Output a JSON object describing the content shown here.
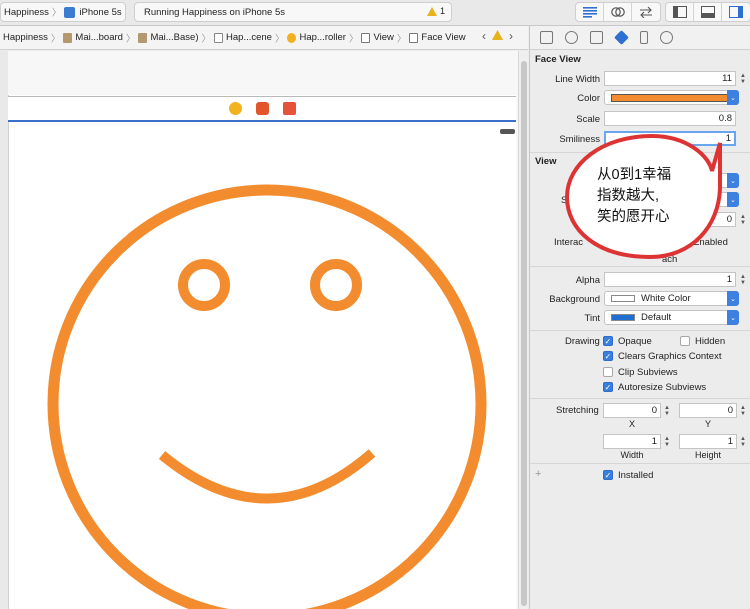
{
  "toolbar": {
    "scheme_app": "Happiness",
    "scheme_device": "iPhone 5s",
    "status_text": "Running Happiness on iPhone 5s",
    "warning_count": "1"
  },
  "jumpbar": {
    "crumbs": [
      "Happiness",
      "Mai...board",
      "Mai...Base)",
      "Hap...cene",
      "Hap...roller",
      "View",
      "Face View"
    ]
  },
  "inspector": {
    "face_view": {
      "title": "Face View",
      "line_width_label": "Line Width",
      "line_width_value": "11",
      "color_label": "Color",
      "color_value": "#F28C2E",
      "scale_label": "Scale",
      "scale_value": "0.8",
      "smiliness_label": "Smiliness",
      "smiliness_value": "1"
    },
    "view": {
      "title": "View",
      "s_label": "S",
      "field3_value": "0",
      "interaction_label": "Interac",
      "enabled_text": "Enabled",
      "touch_text": "ach",
      "alpha_label": "Alpha",
      "alpha_value": "1",
      "background_label": "Background",
      "background_value": "White Color",
      "tint_label": "Tint",
      "tint_value": "Default",
      "drawing_label": "Drawing",
      "opaque": "Opaque",
      "hidden": "Hidden",
      "clears": "Clears Graphics Context",
      "clip": "Clip Subviews",
      "autoresize": "Autoresize Subviews",
      "stretching_label": "Stretching",
      "x_value": "0",
      "y_value": "0",
      "x_label": "X",
      "y_label": "Y",
      "w_value": "1",
      "h_value": "1",
      "width_label": "Width",
      "height_label": "Height",
      "installed": "Installed"
    }
  },
  "callout": {
    "line1": "从0到1幸福",
    "line2": "指数越大,",
    "line3": "笑的愿开心"
  },
  "colors": {
    "face_stroke": "#F28C2E",
    "accent": "#3A7FE0",
    "tint": "#1F6FD0"
  }
}
